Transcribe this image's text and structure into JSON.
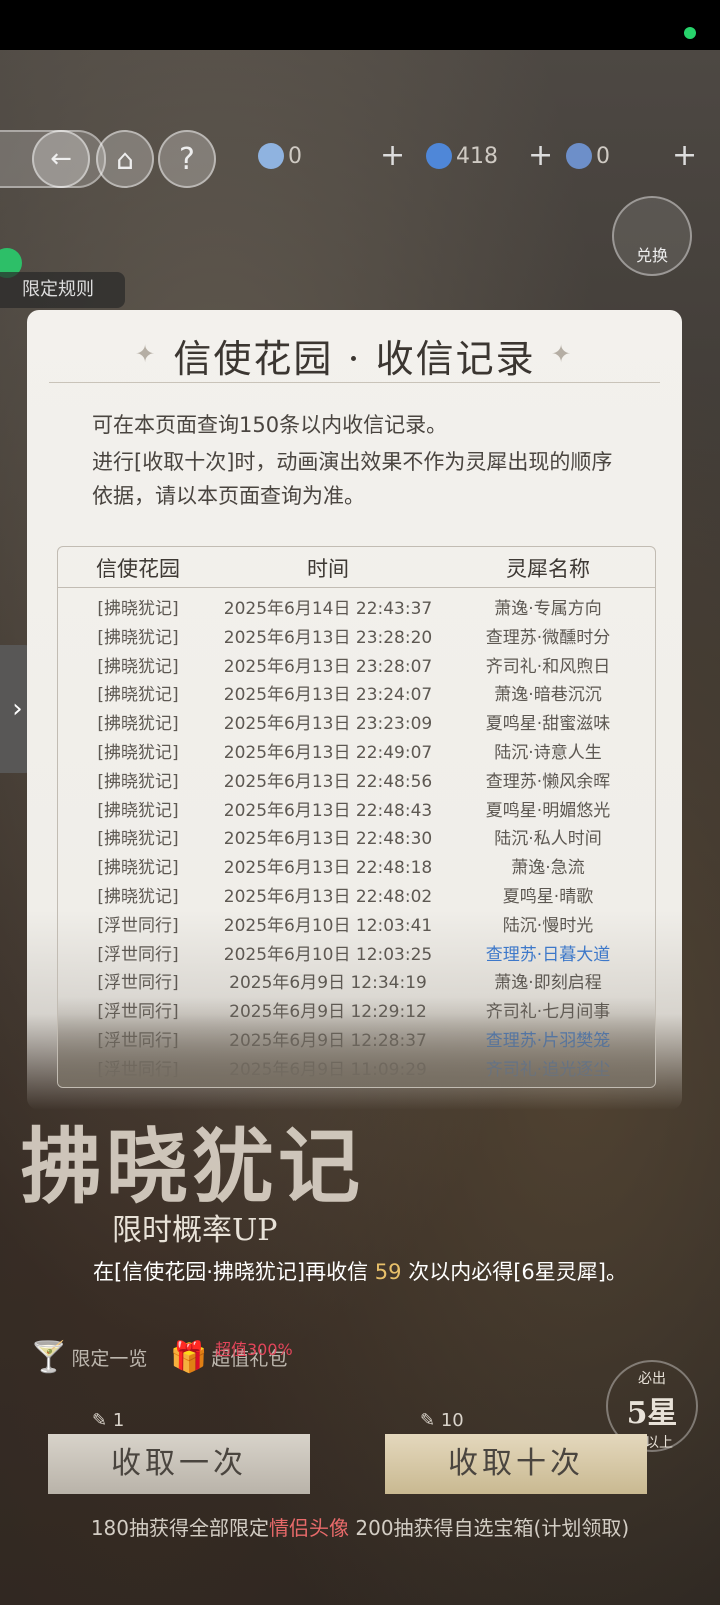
{
  "hud": {
    "currency1": "0",
    "currency2": "418",
    "currency3": "0",
    "exchange_label": "兑换",
    "rules_label": "限定规则"
  },
  "modal": {
    "title": "信使花园 · 收信记录",
    "note_line1": "可在本页面查询150条以内收信记录。",
    "note_line2": "进行[收取十次]时，动画演出效果不作为灵犀出现的顺序",
    "note_line3": "依据，请以本页面查询为准。",
    "columns": [
      "信使花园",
      "时间",
      "灵犀名称"
    ],
    "rows": [
      {
        "garden": "[拂晓犹记]",
        "time": "2025年6月14日 22:43:37",
        "name": "萧逸·专属方向",
        "highlight": false
      },
      {
        "garden": "[拂晓犹记]",
        "time": "2025年6月13日 23:28:20",
        "name": "查理苏·微醺时分",
        "highlight": false
      },
      {
        "garden": "[拂晓犹记]",
        "time": "2025年6月13日 23:28:07",
        "name": "齐司礼·和风煦日",
        "highlight": false
      },
      {
        "garden": "[拂晓犹记]",
        "time": "2025年6月13日 23:24:07",
        "name": "萧逸·暗巷沉沉",
        "highlight": false
      },
      {
        "garden": "[拂晓犹记]",
        "time": "2025年6月13日 23:23:09",
        "name": "夏鸣星·甜蜜滋味",
        "highlight": false
      },
      {
        "garden": "[拂晓犹记]",
        "time": "2025年6月13日 22:49:07",
        "name": "陆沉·诗意人生",
        "highlight": false
      },
      {
        "garden": "[拂晓犹记]",
        "time": "2025年6月13日 22:48:56",
        "name": "查理苏·懒风余晖",
        "highlight": false
      },
      {
        "garden": "[拂晓犹记]",
        "time": "2025年6月13日 22:48:43",
        "name": "夏鸣星·明媚悠光",
        "highlight": false
      },
      {
        "garden": "[拂晓犹记]",
        "time": "2025年6月13日 22:48:30",
        "name": "陆沉·私人时间",
        "highlight": false
      },
      {
        "garden": "[拂晓犹记]",
        "time": "2025年6月13日 22:48:18",
        "name": "萧逸·急流",
        "highlight": false
      },
      {
        "garden": "[拂晓犹记]",
        "time": "2025年6月13日 22:48:02",
        "name": "夏鸣星·晴歌",
        "highlight": false
      },
      {
        "garden": "[浮世同行]",
        "time": "2025年6月10日 12:03:41",
        "name": "陆沉·慢时光",
        "highlight": false
      },
      {
        "garden": "[浮世同行]",
        "time": "2025年6月10日 12:03:25",
        "name": "查理苏·日暮大道",
        "highlight": true
      },
      {
        "garden": "[浮世同行]",
        "time": "2025年6月9日 12:34:19",
        "name": "萧逸·即刻启程",
        "highlight": false
      },
      {
        "garden": "[浮世同行]",
        "time": "2025年6月9日 12:29:12",
        "name": "齐司礼·七月间事",
        "highlight": false
      },
      {
        "garden": "[浮世同行]",
        "time": "2025年6月9日 12:28:37",
        "name": "查理苏·片羽樊笼",
        "highlight": true
      },
      {
        "garden": "[浮世同行]",
        "time": "2025年6月9日 11:09:29",
        "name": "齐司礼·追光逐尘",
        "highlight": true
      }
    ]
  },
  "banner": {
    "title": "拂晓犹记",
    "subtitle": "限时概率UP",
    "guarantee_prefix": "在[信使花园·拂晓犹记]再收信 ",
    "guarantee_num": "59",
    "guarantee_suffix": " 次以内必得[6星灵犀]。"
  },
  "bottom": {
    "limited_list": "限定一览",
    "gift_pack": "超值礼包",
    "gift_badge": "超值300%",
    "five_star_top": "必出",
    "five_star_mid": "5星",
    "five_star_bot": "或以上",
    "pull_one_label": "收取一次",
    "pull_one_cost": "1",
    "pull_ten_label": "收取十次",
    "pull_ten_cost": "10",
    "footer_prefix": "180抽获得全部限定",
    "footer_highlight": "情侣头像",
    "footer_suffix": " 200抽获得自选宝箱(计划领取)"
  }
}
